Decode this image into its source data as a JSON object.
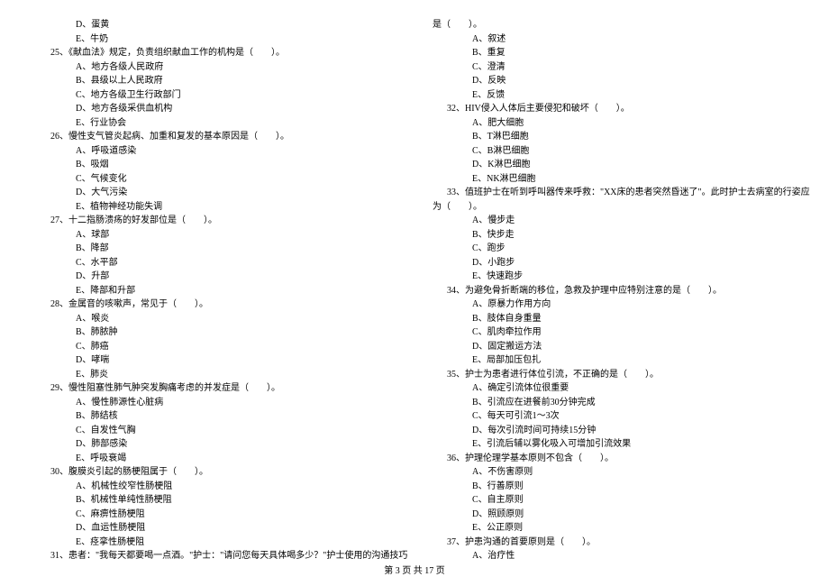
{
  "left": {
    "pre_opts": [
      "D、蛋黄",
      "E、牛奶"
    ],
    "q25": {
      "stem": "25、《献血法》规定，负责组织献血工作的机构是（　　）。",
      "opts": [
        "A、地方各级人民政府",
        "B、县级以上人民政府",
        "C、地方各级卫生行政部门",
        "D、地方各级采供血机构",
        "E、行业协会"
      ]
    },
    "q26": {
      "stem": "26、慢性支气管炎起病、加重和复发的基本原因是（　　）。",
      "opts": [
        "A、呼吸道感染",
        "B、吸烟",
        "C、气候变化",
        "D、大气污染",
        "E、植物神经功能失调"
      ]
    },
    "q27": {
      "stem": "27、十二指肠溃疡的好发部位是（　　）。",
      "opts": [
        "A、球部",
        "B、降部",
        "C、水平部",
        "D、升部",
        "E、降部和升部"
      ]
    },
    "q28": {
      "stem": "28、金属音的咳嗽声，常见于（　　）。",
      "opts": [
        "A、喉炎",
        "B、肺脓肿",
        "C、肺癌",
        "D、哮喘",
        "E、肺炎"
      ]
    },
    "q29": {
      "stem": "29、慢性阻塞性肺气肿突发胸痛考虑的并发症是（　　）。",
      "opts": [
        "A、慢性肺源性心脏病",
        "B、肺结核",
        "C、自发性气胸",
        "D、肺部感染",
        "E、呼吸衰竭"
      ]
    },
    "q30": {
      "stem": "30、腹膜炎引起的肠梗阻属于（　　）。",
      "opts": [
        "A、机械性绞窄性肠梗阻",
        "B、机械性单纯性肠梗阻",
        "C、麻痹性肠梗阻",
        "D、血运性肠梗阻",
        "E、痉挛性肠梗阻"
      ]
    },
    "q31": {
      "stem": "31、患者：\"我每天都要喝一点酒。\"护士：\"请问您每天具体喝多少？\"护士使用的沟通技巧"
    }
  },
  "right": {
    "q31_cont": {
      "stem": "是（　　）。",
      "opts": [
        "A、叙述",
        "B、重复",
        "C、澄清",
        "D、反映",
        "E、反馈"
      ]
    },
    "q32": {
      "stem": "32、HIV侵入人体后主要侵犯和破坏（　　）。",
      "opts": [
        "A、肥大细胞",
        "B、T淋巴细胞",
        "C、B淋巴细胞",
        "D、K淋巴细胞",
        "E、NK淋巴细胞"
      ]
    },
    "q33": {
      "stem1": "33、值班护士在听到呼叫器传来呼救：\"XX床的患者突然昏迷了\"。此时护士去病室的行姿应",
      "stem2": "为（　　）。",
      "opts": [
        "A、慢步走",
        "B、快步走",
        "C、跑步",
        "D、小跑步",
        "E、快速跑步"
      ]
    },
    "q34": {
      "stem": "34、为避免骨折断端的移位，急救及护理中应特别注意的是（　　）。",
      "opts": [
        "A、原暴力作用方向",
        "B、肢体自身重量",
        "C、肌肉牵拉作用",
        "D、固定搬运方法",
        "E、局部加压包扎"
      ]
    },
    "q35": {
      "stem": "35、护士为患者进行体位引流，不正确的是（　　）。",
      "opts": [
        "A、确定引流体位很重要",
        "B、引流应在进餐前30分钟完成",
        "C、每天可引流1～3次",
        "D、每次引流时间可持续15分钟",
        "E、引流后辅以雾化吸入可增加引流效果"
      ]
    },
    "q36": {
      "stem": "36、护理伦理学基本原则不包含（　　）。",
      "opts": [
        "A、不伤害原则",
        "B、行善原则",
        "C、自主原则",
        "D、照顾原则",
        "E、公正原则"
      ]
    },
    "q37": {
      "stem": "37、护患沟通的首要原则是（　　）。",
      "opts": [
        "A、治疗性"
      ]
    }
  },
  "footer": "第 3 页 共 17 页"
}
